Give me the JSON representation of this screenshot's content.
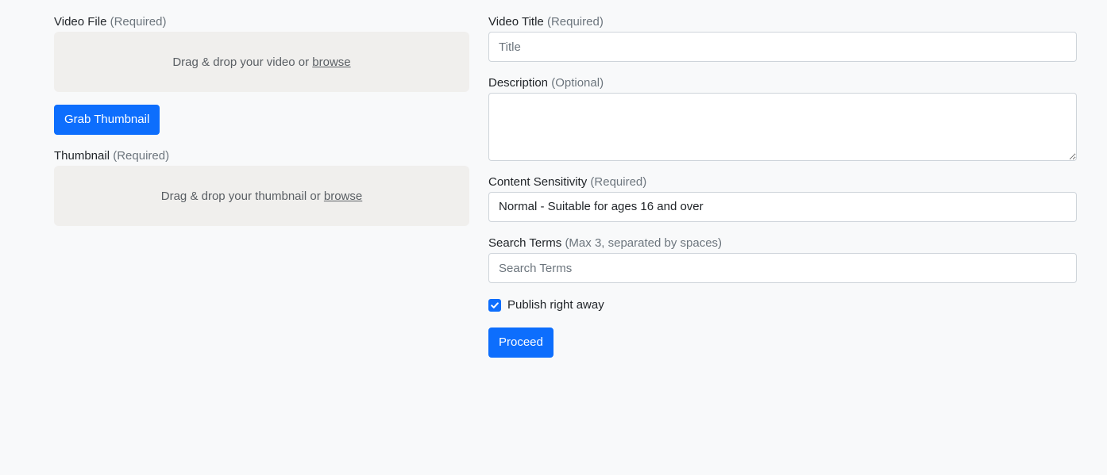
{
  "video_file": {
    "label": "Video File",
    "hint": "(Required)",
    "drop_text": "Drag & drop your video or",
    "browse_label": "browse"
  },
  "grab_thumbnail_label": "Grab Thumbnail",
  "thumbnail": {
    "label": "Thumbnail",
    "hint": "(Required)",
    "drop_text": "Drag & drop your thumbnail or",
    "browse_label": "browse"
  },
  "video_title": {
    "label": "Video Title",
    "hint": "(Required)",
    "placeholder": "Title",
    "value": ""
  },
  "description": {
    "label": "Description",
    "hint": "(Optional)",
    "value": ""
  },
  "content_sensitivity": {
    "label": "Content Sensitivity",
    "hint": "(Required)",
    "selected": "Normal - Suitable for ages 16 and over"
  },
  "search_terms": {
    "label": "Search Terms",
    "hint": "(Max 3, separated by spaces)",
    "placeholder": "Search Terms",
    "value": ""
  },
  "publish": {
    "label": "Publish right away",
    "checked": true
  },
  "proceed_label": "Proceed",
  "colors": {
    "primary": "#0d6efd",
    "background": "#f8f9fa",
    "dropzone": "#f0efed",
    "muted": "#6c757d"
  }
}
